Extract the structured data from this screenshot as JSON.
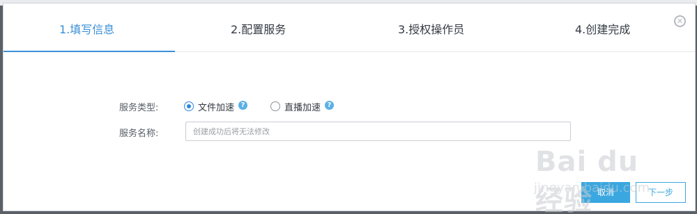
{
  "wizard": {
    "steps": [
      {
        "label": "1.填写信息",
        "active": true
      },
      {
        "label": "2.配置服务",
        "active": false
      },
      {
        "label": "3.授权操作员",
        "active": false
      },
      {
        "label": "4.创建完成",
        "active": false
      }
    ],
    "close_icon": "close-circle-icon",
    "accent_color": "#3a8fd6"
  },
  "form": {
    "service_type_label": "服务类型:",
    "service_type_options": [
      {
        "label": "文件加速",
        "checked": true,
        "help_icon": "question-icon"
      },
      {
        "label": "直播加速",
        "checked": false,
        "help_icon": "question-icon"
      }
    ],
    "service_name_label": "服务名称:",
    "service_name_value": "",
    "service_name_placeholder": "创建成功后将无法修改"
  },
  "footer": {
    "primary_label": "取消",
    "secondary_label": "下一步"
  },
  "watermark": {
    "logo_text": "Bai du 经验",
    "url_text": "jingyan.baidu.com"
  }
}
